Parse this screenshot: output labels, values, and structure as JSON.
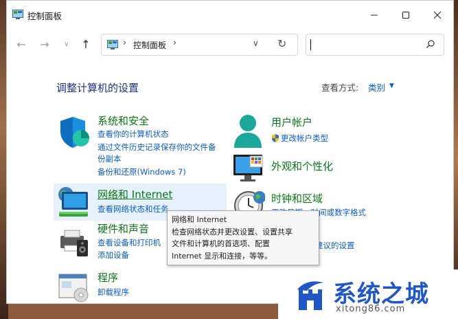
{
  "window": {
    "title": "控制面板"
  },
  "navigation": {
    "address_crumb": "控制面板"
  },
  "page": {
    "heading": "调整计算机的设置",
    "view_by_label": "查看方式:",
    "view_by_value": "类别"
  },
  "categories": {
    "system_security": {
      "title": "系统和安全",
      "links": [
        "查看你的计算机状态",
        "通过文件历史记录保存你的文件备",
        "份副本",
        "备份和还原(Windows 7)"
      ]
    },
    "user_accounts": {
      "title": "用户帐户",
      "links": [
        "更改帐户类型"
      ]
    },
    "network": {
      "title": "网络和 Internet",
      "links": [
        "查看网络状态和任务"
      ]
    },
    "appearance": {
      "title": "外观和个性化",
      "links": []
    },
    "hardware": {
      "title": "硬件和声音",
      "links": [
        "查看设备和打印机",
        "添加设备"
      ]
    },
    "clock": {
      "title": "时钟和区域",
      "links": [
        "更改日期、时间或数字格式"
      ]
    },
    "programs": {
      "title": "程序",
      "links": [
        "卸载程序"
      ]
    },
    "ease": {
      "partial_link": "ws 建议的设置"
    }
  },
  "tooltip": {
    "lines": [
      "网络和 Internet",
      "检查网络状态并更改设置、设置共享",
      "文件和计算机的首选项、配置",
      "Internet 显示和连接，等等。"
    ]
  },
  "watermark": {
    "title": "系统之城",
    "url": "xitong86.com"
  },
  "colors": {
    "category_title": "#0a7a18",
    "link": "#0b5ec9",
    "heading": "#1e3287",
    "hover": "#e6f1fb"
  }
}
